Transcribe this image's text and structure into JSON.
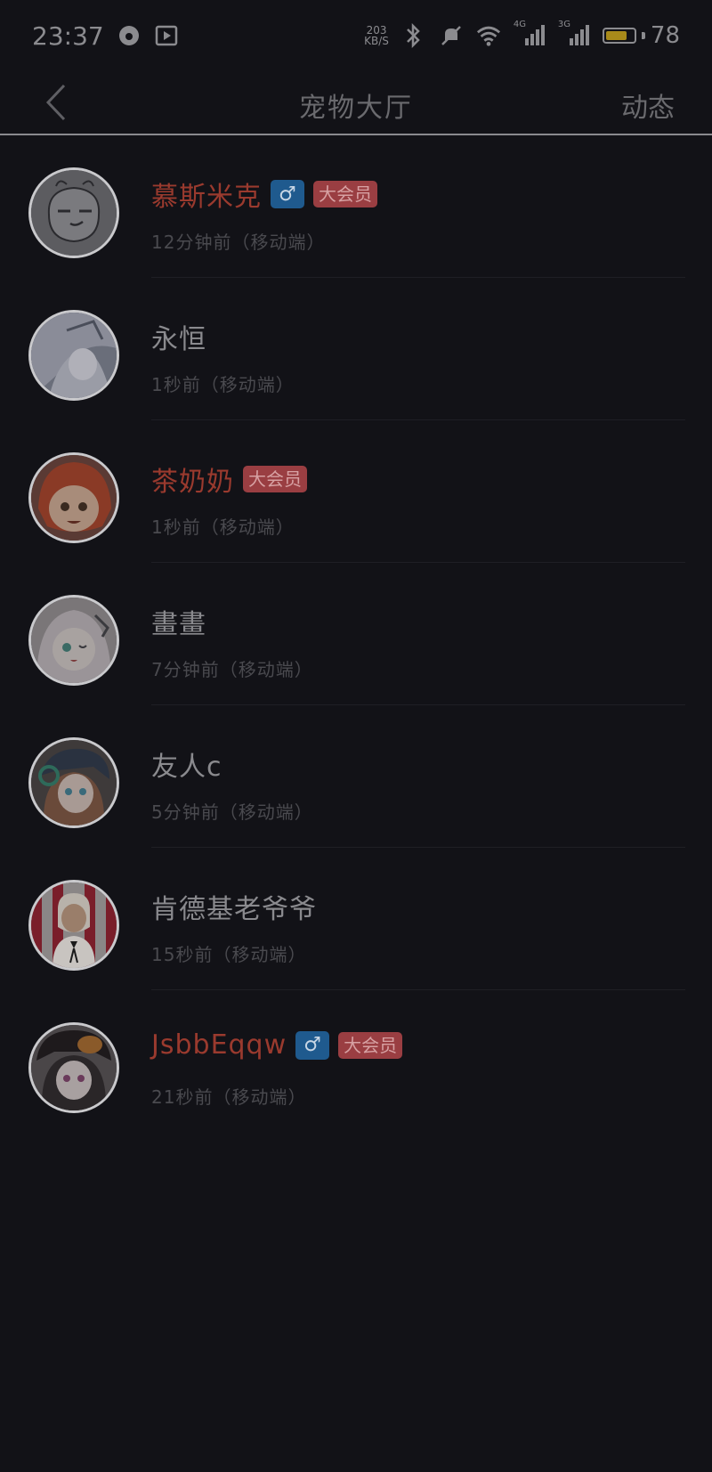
{
  "status_bar": {
    "time": "23:37",
    "net_speed_value": "203",
    "net_speed_unit": "KB/S",
    "signal_1_label": "4G",
    "signal_2_label": "3G",
    "battery": "78",
    "battery_level": 0.78
  },
  "header": {
    "title": "宠物大厅",
    "action": "动态"
  },
  "users": [
    {
      "name": "慕斯米克",
      "vip": true,
      "gender": "♂",
      "badge": "大会员",
      "time": "12分钟前（移动端）"
    },
    {
      "name": "永恒",
      "vip": false,
      "gender": "",
      "badge": "",
      "time": "1秒前（移动端）"
    },
    {
      "name": "茶奶奶",
      "vip": true,
      "gender": "",
      "badge": "大会员",
      "time": "1秒前（移动端）"
    },
    {
      "name": "畫畫",
      "vip": false,
      "gender": "",
      "badge": "",
      "time": "7分钟前（移动端）"
    },
    {
      "name": "友人c",
      "vip": false,
      "gender": "",
      "badge": "",
      "time": "5分钟前（移动端）"
    },
    {
      "name": "肯德基老爷爷",
      "vip": false,
      "gender": "",
      "badge": "",
      "time": "15秒前（移动端）"
    },
    {
      "name": "JsbbEqqw",
      "vip": true,
      "gender": "♂",
      "badge": "大会员",
      "time": "21秒前（移动端）"
    }
  ],
  "colors": {
    "background": "#121217",
    "vip_name": "#9a3a2e",
    "gender_badge": "#1f5a8e",
    "vip_badge": "#9a3e42"
  }
}
